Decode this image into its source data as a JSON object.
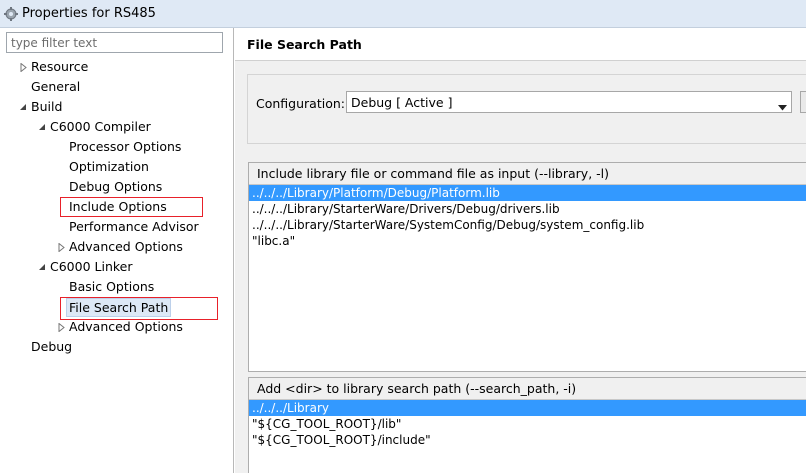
{
  "window": {
    "title": "Properties for RS485"
  },
  "sidebar": {
    "filter_placeholder": "type filter text",
    "tree": [
      {
        "label": "Resource",
        "level": 0,
        "twisty": "collapsed"
      },
      {
        "label": "General",
        "level": 0,
        "twisty": "none"
      },
      {
        "label": "Build",
        "level": 0,
        "twisty": "expanded"
      },
      {
        "label": "C6000 Compiler",
        "level": 1,
        "twisty": "expanded"
      },
      {
        "label": "Processor Options",
        "level": 2,
        "twisty": "none"
      },
      {
        "label": "Optimization",
        "level": 2,
        "twisty": "none"
      },
      {
        "label": "Debug Options",
        "level": 2,
        "twisty": "none"
      },
      {
        "label": "Include Options",
        "level": 2,
        "twisty": "none",
        "highlight": true
      },
      {
        "label": "Performance Advisor",
        "level": 2,
        "twisty": "none"
      },
      {
        "label": "Advanced Options",
        "level": 2,
        "twisty": "collapsed"
      },
      {
        "label": "C6000 Linker",
        "level": 1,
        "twisty": "expanded"
      },
      {
        "label": "Basic Options",
        "level": 2,
        "twisty": "none"
      },
      {
        "label": "File Search Path",
        "level": 2,
        "twisty": "none",
        "highlight": true,
        "selected": true
      },
      {
        "label": "Advanced Options",
        "level": 2,
        "twisty": "collapsed"
      },
      {
        "label": "Debug",
        "level": 0,
        "twisty": "none"
      }
    ]
  },
  "main": {
    "page_title": "File Search Path",
    "configuration": {
      "label": "Configuration:",
      "selected_value": "Debug  [ Active ]"
    },
    "library_list": {
      "header": "Include library file or command file as input (--library, -l)",
      "items": [
        "../../../Library/Platform/Debug/Platform.lib",
        "../../../Library/StarterWare/Drivers/Debug/drivers.lib",
        "../../../Library/StarterWare/SystemConfig/Debug/system_config.lib",
        "\"libc.a\""
      ],
      "selected_index": 0
    },
    "search_path_list": {
      "header": "Add <dir> to library search path (--search_path, -i)",
      "items": [
        "../../../Library",
        "\"${CG_TOOL_ROOT}/lib\"",
        "\"${CG_TOOL_ROOT}/include\""
      ],
      "selected_index": 0
    }
  },
  "colors": {
    "selection_blue": "#3399ff",
    "highlight_red": "#e8212a",
    "titlebar_bg": "#dfe9f5"
  },
  "icons": {
    "app": "gear-icon",
    "twisty_collapsed": "triangle-right-icon",
    "twisty_expanded": "triangle-down-icon",
    "dropdown": "chevron-down-icon"
  }
}
